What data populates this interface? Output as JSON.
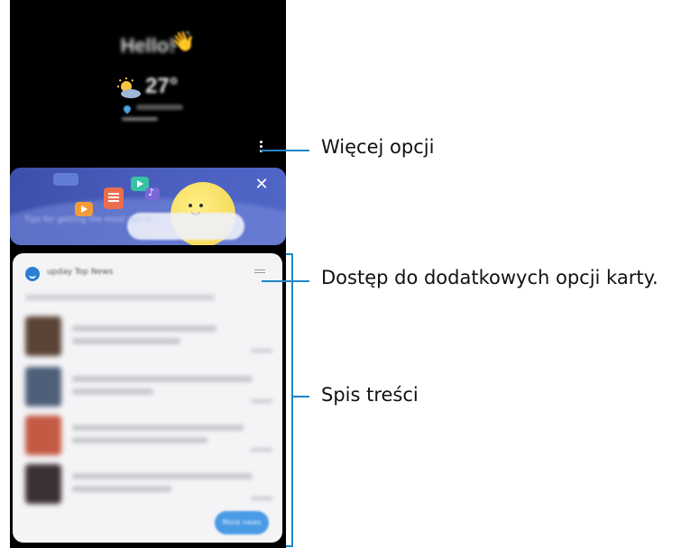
{
  "home": {
    "greeting": "Hello!",
    "greeting_emoji": "👋",
    "weather_icon": "partly-sunny-icon",
    "temperature": "27°"
  },
  "banner": {
    "text": "Tips for getting the most out of...",
    "close_label": "✕"
  },
  "card": {
    "title": "upday Top News",
    "more_button": "More news"
  },
  "callouts": {
    "more_options": "Więcej opcji",
    "card_options": "Dostęp do dodatkowych opcji karty.",
    "content_list": "Spis treści"
  },
  "colors": {
    "callout_blue": "#1f86c8",
    "banner_blue": "#4b5fbf",
    "card_bg": "#f4f4f6"
  }
}
